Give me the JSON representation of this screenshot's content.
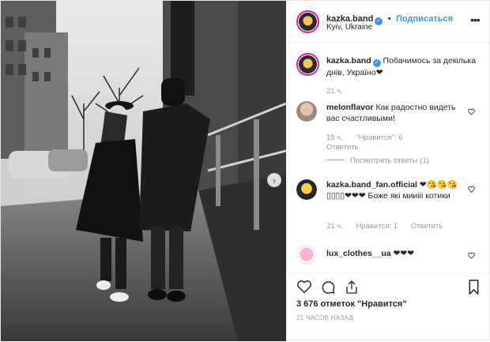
{
  "post": {
    "username": "kazka.band",
    "follow_label": "Подписаться",
    "location": "Kyiv, Ukraine",
    "caption": "Побачимось за декілька днів, Україно❤",
    "caption_time": "21 ч.",
    "likes": "3 676 отметок \"Нравится\"",
    "posted_time": "21 ЧАСОВ НАЗАД"
  },
  "comments": [
    {
      "username": "melonflavor",
      "text": "Как радостно видеть вас счастливыми!",
      "time": "19 ч.",
      "likes": "\"Нравится\": 6",
      "reply": "Ответить",
      "view_replies": "Посмотреть ответы (1)"
    },
    {
      "username": "kazka.band_fan.official",
      "text": "❤😘😘😘 ▯▯▯▯❤❤❤ Боже які мииііі котики",
      "time": "21 ч.",
      "likes": "Нравится: 1",
      "reply": "Ответить"
    },
    {
      "username": "lux_clothes__ua",
      "text": "❤❤❤"
    }
  ],
  "icons": {
    "verified": "✓",
    "more": "•••",
    "next": "›"
  },
  "colors": {
    "link": "#3897f0",
    "ring": "#d6249f",
    "muted": "#999999"
  }
}
